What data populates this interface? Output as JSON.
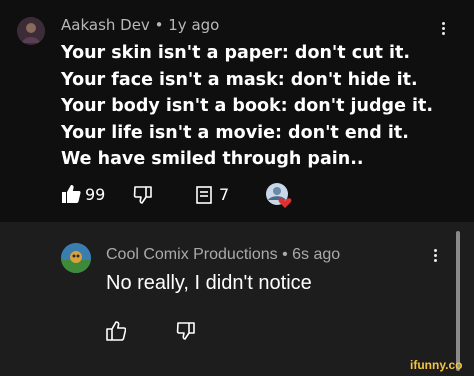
{
  "comments": [
    {
      "author": "Aakash Dev",
      "time": "1y ago",
      "lines": [
        "Your skin isn't a paper: don't cut it.",
        "Your face isn't a mask: don't hide it.",
        "Your body isn't a book: don't judge it.",
        "Your life isn't a movie: don't end it.",
        "We have smiled through pain.."
      ],
      "likes": "99",
      "replies": "7"
    },
    {
      "author": "Cool Comix Productions",
      "time": "6s ago",
      "text": "No really, I didn't notice"
    }
  ],
  "watermark": "ifunny.co",
  "separator": "•",
  "colors": {
    "background": "#0f0f0f",
    "reply_background": "#1d1d1d",
    "heart": "#e03131"
  },
  "icons": [
    "thumbs-up-icon",
    "thumbs-down-icon",
    "reply-icon",
    "more-vert-icon",
    "heart-icon"
  ]
}
